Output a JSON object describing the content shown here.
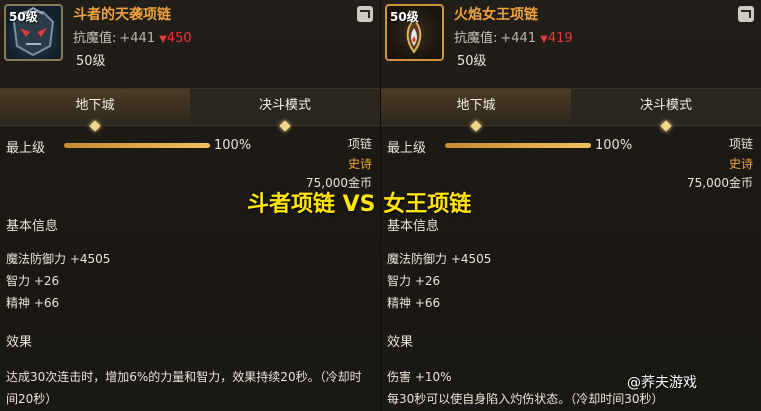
{
  "left": {
    "item_level_badge": "50级",
    "item_name": "斗者的天袭项链",
    "stat_label": "抗魔值:",
    "stat_plus": "+441",
    "stat_down": "450",
    "level_text": "50级",
    "tabs": [
      {
        "label": "地下城"
      },
      {
        "label": "决斗模式"
      }
    ],
    "enhance_label": "最上级",
    "enhance_percent": "100%",
    "enhance_value": 1.0,
    "type_label": "项链",
    "rarity": "史诗",
    "price": "75,000金币",
    "basic_title": "基本信息",
    "stats": [
      "魔法防御力 +4505",
      "智力 +26",
      "精神 +66"
    ],
    "effect_title": "效果",
    "effect_text": "达成30次连击时，增加6%的力量和智力，效果持续20秒。（冷却时间20秒）"
  },
  "right": {
    "item_level_badge": "50级",
    "item_name": "火焰女王项链",
    "stat_label": "抗魔值:",
    "stat_plus": "+441",
    "stat_down": "419",
    "level_text": "50级",
    "tabs": [
      {
        "label": "地下城"
      },
      {
        "label": "决斗模式"
      }
    ],
    "enhance_label": "最上级",
    "enhance_percent": "100%",
    "enhance_value": 1.0,
    "type_label": "项链",
    "rarity": "史诗",
    "price": "75,000金币",
    "basic_title": "基本信息",
    "stats": [
      "魔法防御力 +4505",
      "智力 +26",
      "精神 +66"
    ],
    "effect_title": "效果",
    "effect_text": "伤害 +10%\n每30秒可以使自身陷入灼伤状态。（冷却时间30秒）"
  },
  "overlay_title": "斗者项链 VS 女王项链",
  "watermark": "@荞夫游戏",
  "colors": {
    "item_name": "#f0a33b",
    "rarity": "#f0a33b",
    "stat_down": "#e23b3b",
    "overlay_title": "#ffe600",
    "progress": "#f3c25a"
  },
  "icons": [
    "mask-helm-icon",
    "flame-pendant-icon",
    "share-icon",
    "down-arrow-icon"
  ]
}
